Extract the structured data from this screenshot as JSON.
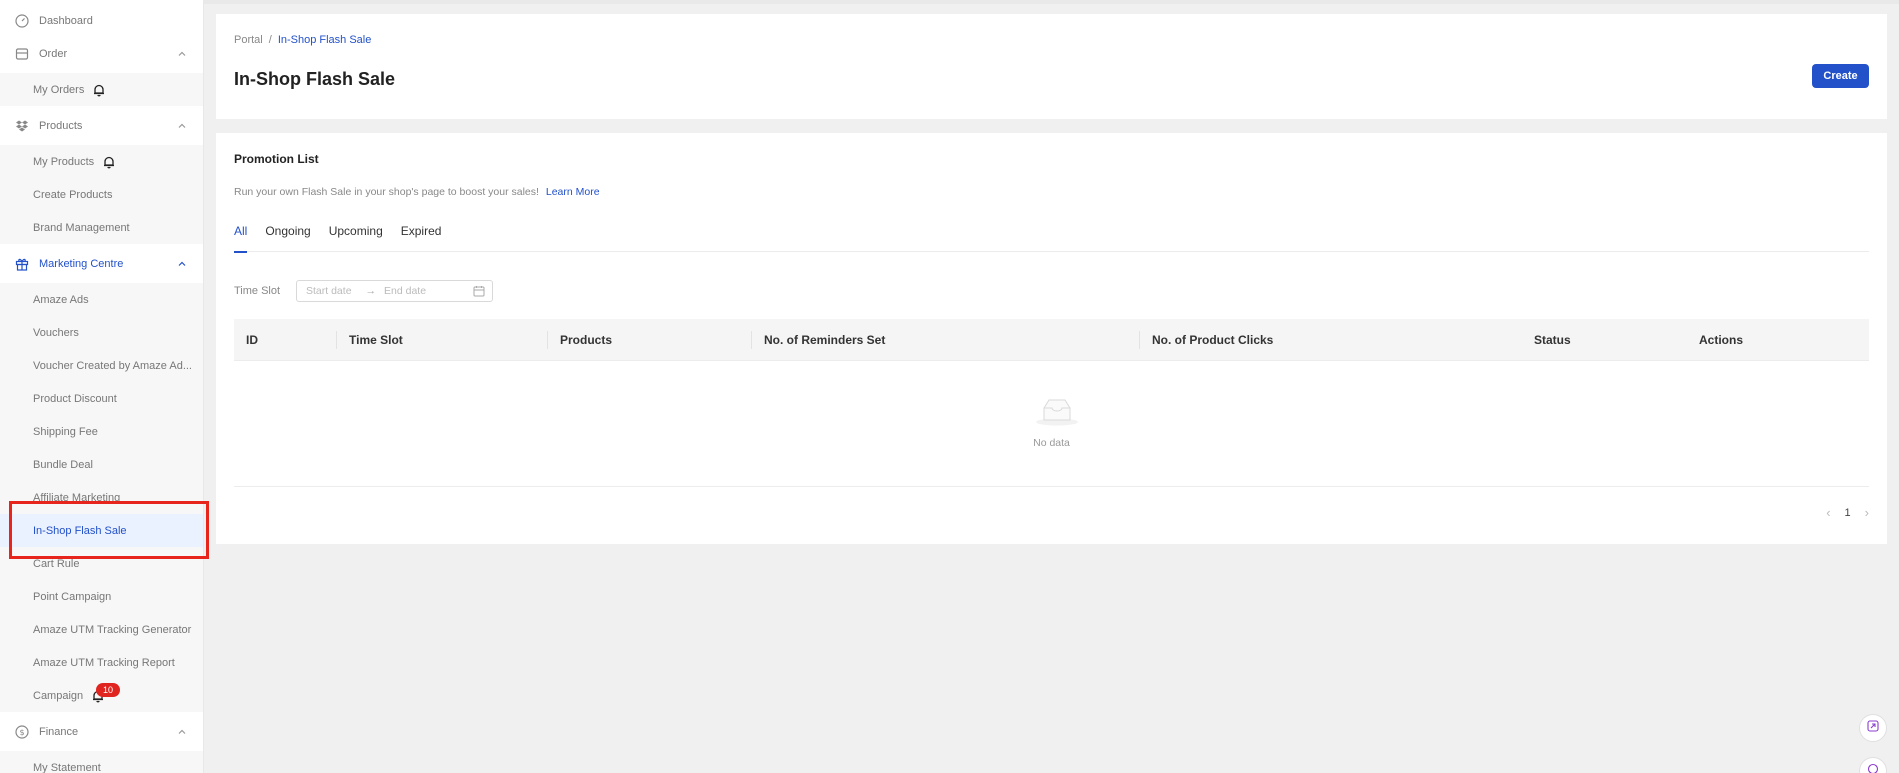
{
  "sidebar": {
    "dashboard": "Dashboard",
    "order": {
      "label": "Order",
      "items": [
        "My Orders"
      ]
    },
    "products": {
      "label": "Products",
      "items": [
        "My Products",
        "Create Products",
        "Brand Management"
      ]
    },
    "marketing": {
      "label": "Marketing Centre",
      "items": [
        "Amaze Ads",
        "Vouchers",
        "Voucher Created by Amaze Ad...",
        "Product Discount",
        "Shipping Fee",
        "Bundle Deal",
        "Affiliate Marketing",
        "In-Shop Flash Sale",
        "Cart Rule",
        "Point Campaign",
        "Amaze UTM Tracking Generator",
        "Amaze UTM Tracking Report",
        "Campaign"
      ],
      "campaign_badge": "10"
    },
    "finance": {
      "label": "Finance",
      "items": [
        "My Statement"
      ]
    }
  },
  "header": {
    "breadcrumb_root": "Portal",
    "breadcrumb_sep": "/",
    "breadcrumb_current": "In-Shop Flash Sale",
    "title": "In-Shop Flash Sale",
    "create_label": "Create"
  },
  "promotion": {
    "title": "Promotion List",
    "description": "Run your own Flash Sale in your shop's page to boost your sales!",
    "learn_more": "Learn More",
    "tabs": [
      "All",
      "Ongoing",
      "Upcoming",
      "Expired"
    ],
    "filter_label": "Time Slot",
    "start_placeholder": "Start date",
    "end_placeholder": "End date",
    "columns": [
      "ID",
      "Time Slot",
      "Products",
      "No. of Reminders Set",
      "No. of Product Clicks",
      "Status",
      "Actions"
    ],
    "empty_text": "No data",
    "page": "1"
  },
  "colors": {
    "accent": "#2251c9",
    "badge": "#e0241f",
    "highlight": "#e8251c"
  }
}
